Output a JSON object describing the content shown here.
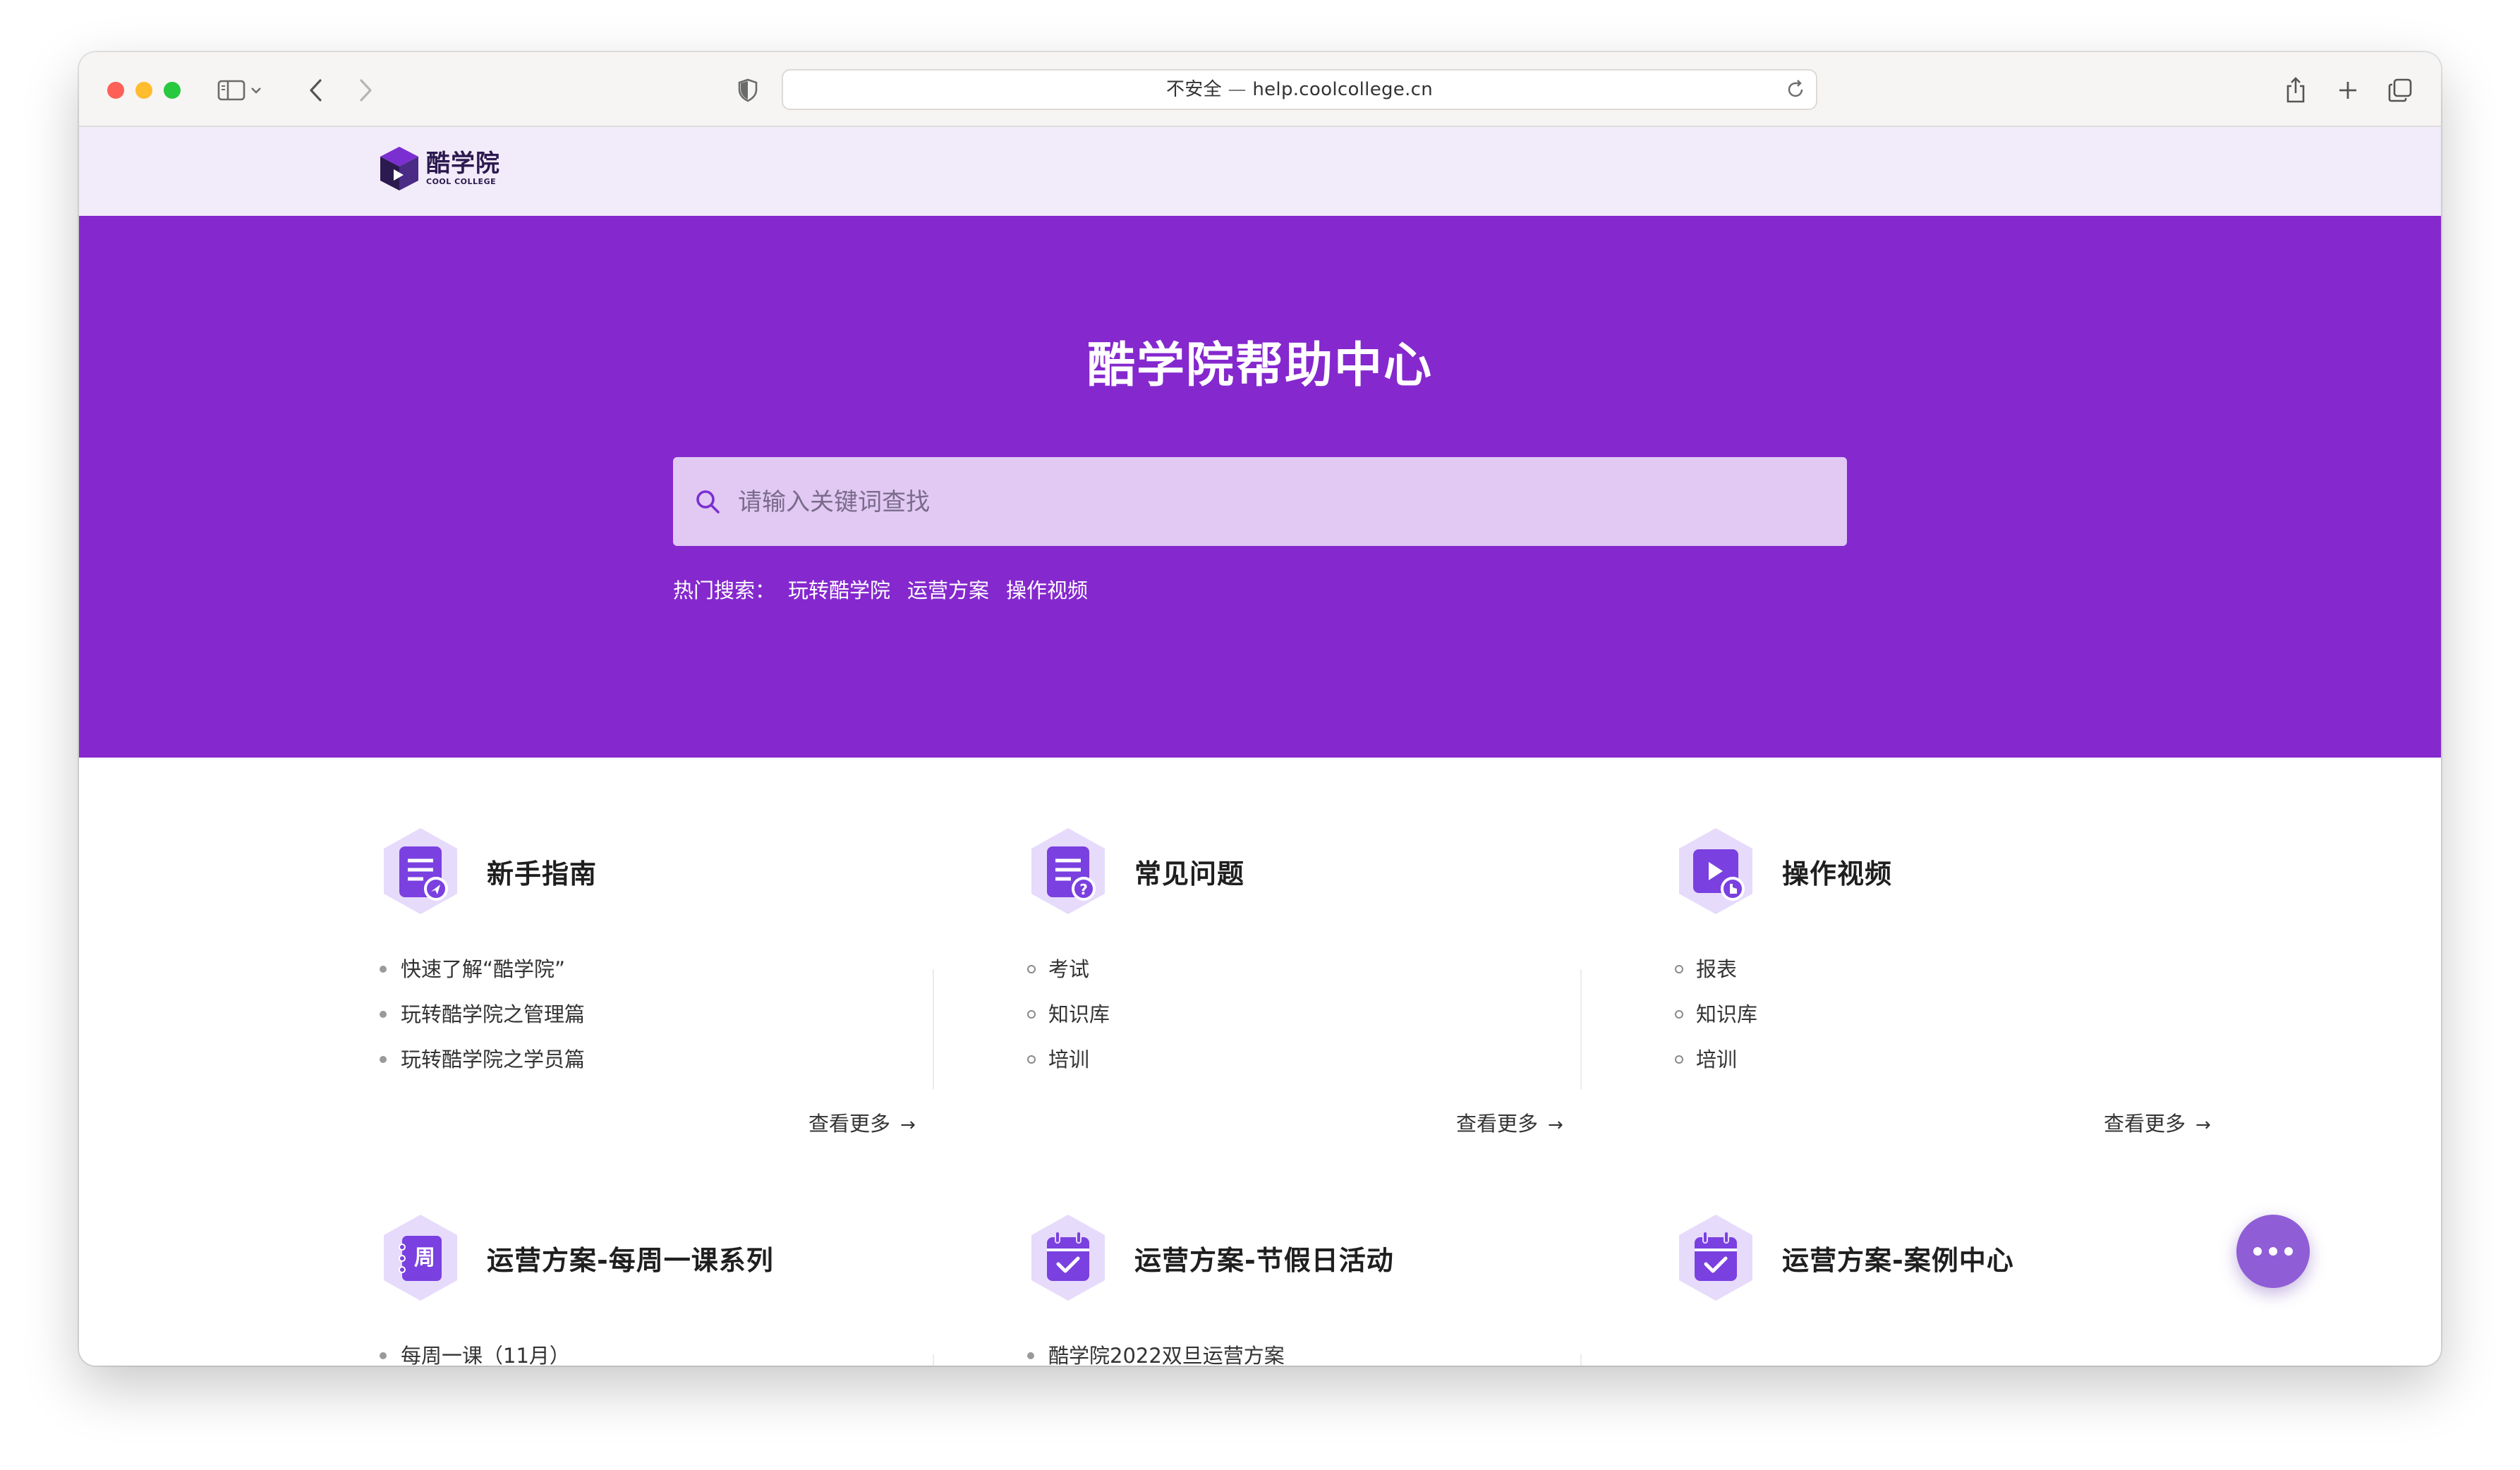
{
  "browser": {
    "url_security": "不安全",
    "url_separator": "—",
    "url_domain": "help.coolcollege.cn"
  },
  "site": {
    "logo_cn": "酷学院",
    "logo_en": "COOL COLLEGE"
  },
  "hero": {
    "title": "酷学院帮助中心",
    "search_placeholder": "请输入关键词查找",
    "hot_label": "热门搜索：",
    "hot_links": [
      "玩转酷学院",
      "运营方案",
      "操作视频"
    ]
  },
  "cards": [
    {
      "title": "新手指南",
      "icon": "guide-icon",
      "items": [
        "快速了解“酷学院”",
        "玩转酷学院之管理篇",
        "玩转酷学院之学员篇"
      ],
      "more": "查看更多"
    },
    {
      "title": "常见问题",
      "icon": "faq-icon",
      "items": [
        "考试",
        "知识库",
        "培训"
      ],
      "more": "查看更多"
    },
    {
      "title": "操作视频",
      "icon": "video-icon",
      "items": [
        "报表",
        "知识库",
        "培训"
      ],
      "more": "查看更多"
    },
    {
      "title": "运营方案-每周一课系列",
      "icon": "weekly-calendar-icon",
      "icon_text": "周",
      "items": [
        "每周一课（11月）"
      ]
    },
    {
      "title": "运营方案-节假日活动",
      "icon": "calendar-check-icon",
      "items": [
        "酷学院2022双旦运营方案"
      ]
    },
    {
      "title": "运营方案-案例中心",
      "icon": "calendar-check-icon",
      "items": []
    }
  ],
  "colors": {
    "brand_purple": "#8528ce",
    "header_bg": "#f2ebfa",
    "search_bg": "#e1c9f3",
    "icon_purple": "#7a40e0",
    "chat_button": "#8f5ed6"
  }
}
